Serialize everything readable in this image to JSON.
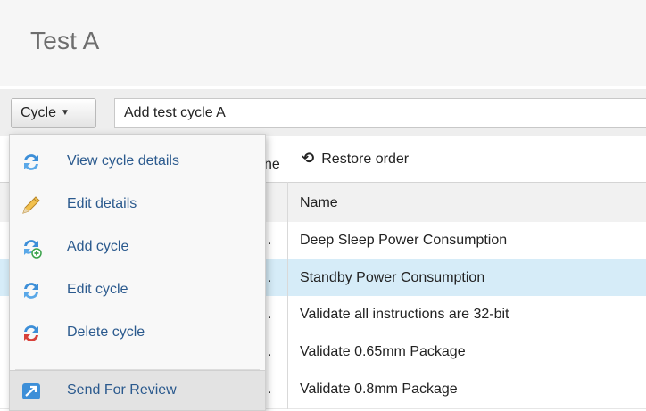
{
  "page": {
    "title": "Test A"
  },
  "toolbar": {
    "cycle_button": "Cycle",
    "cycle_input_value": "Add test cycle A"
  },
  "grid": {
    "partial_label": "ne",
    "restore_label": "Restore order",
    "header_name": "Name",
    "rows": [
      {
        "marker": ".",
        "name": "Deep Sleep Power Consumption",
        "selected": false
      },
      {
        "marker": ".",
        "name": "Standby Power Consumption",
        "selected": true
      },
      {
        "marker": ".",
        "name": "Validate all instructions are 32-bit",
        "selected": false
      },
      {
        "marker": ".",
        "name": "Validate 0.65mm Package",
        "selected": false
      },
      {
        "marker": ".",
        "name": "Validate 0.8mm Package",
        "selected": false
      }
    ]
  },
  "menu": {
    "items": [
      {
        "label": "View cycle details",
        "icon": "cycle-view-icon"
      },
      {
        "label": "Edit details",
        "icon": "pencil-icon"
      },
      {
        "label": "Add cycle",
        "icon": "cycle-add-icon"
      },
      {
        "label": "Edit cycle",
        "icon": "cycle-edit-icon"
      },
      {
        "label": "Delete cycle",
        "icon": "cycle-delete-icon"
      },
      {
        "label": "Send For Review",
        "icon": "send-review-icon"
      }
    ]
  },
  "colors": {
    "link_blue": "#2b5a8e",
    "selected_row": "#d6ecf8",
    "cycle_icon_blue": "#3d8fd8",
    "delete_red": "#d8413a",
    "add_green": "#3aa24a"
  }
}
